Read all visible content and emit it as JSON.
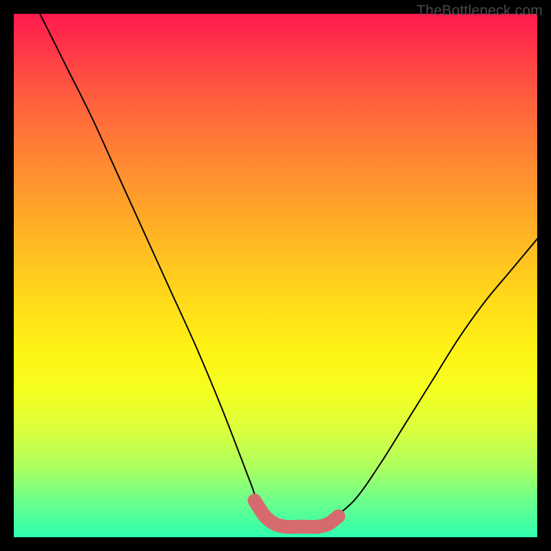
{
  "watermark": "TheBottleneck.com",
  "colors": {
    "marker": "#d76a6e",
    "curve": "#000000"
  },
  "chart_data": {
    "type": "line",
    "title": "",
    "xlabel": "",
    "ylabel": "",
    "xlim": [
      0,
      100
    ],
    "ylim": [
      0,
      100
    ],
    "grid": false,
    "series": [
      {
        "name": "bottleneck-curve",
        "x": [
          5,
          10,
          15,
          20,
          25,
          30,
          35,
          40,
          45,
          47,
          50,
          53,
          55,
          58,
          60,
          65,
          70,
          75,
          80,
          85,
          90,
          95,
          100
        ],
        "y": [
          100,
          90,
          80,
          69,
          58,
          47,
          36,
          24,
          11,
          6,
          3,
          2,
          2,
          2,
          3,
          7,
          14,
          22,
          30,
          38,
          45,
          51,
          57
        ]
      }
    ],
    "highlight": {
      "name": "optimal-region",
      "x": [
        46,
        48,
        50,
        52,
        54,
        56,
        58,
        60,
        62
      ],
      "y": [
        7,
        4,
        2.5,
        2,
        2,
        2,
        2,
        2.5,
        4
      ]
    }
  }
}
